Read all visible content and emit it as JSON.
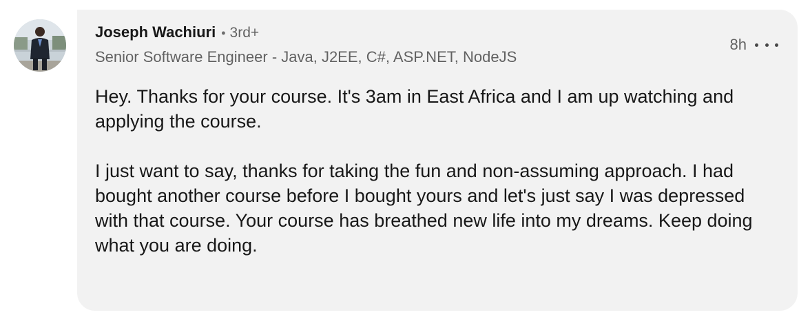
{
  "author": {
    "name": "Joseph Wachiuri",
    "degree": "3rd+",
    "headline": "Senior Software Engineer - Java, J2EE, C#, ASP.NET, NodeJS",
    "avatar_icon": "person-photo-icon"
  },
  "meta": {
    "time": "8h",
    "more_icon": "ellipsis-icon"
  },
  "comment": {
    "paragraphs": [
      "Hey. Thanks for your course. It's 3am in East Africa and I am up watching and applying the course.",
      "I just want to say, thanks for taking the fun and non-assuming approach. I had bought another course before I bought yours and let's just say I was depressed with that course. Your course has breathed new life into my dreams. Keep doing what you are doing."
    ]
  },
  "colors": {
    "bubble_background": "#f2f2f2",
    "text_primary": "#1a1a1a",
    "text_secondary": "#666666"
  }
}
